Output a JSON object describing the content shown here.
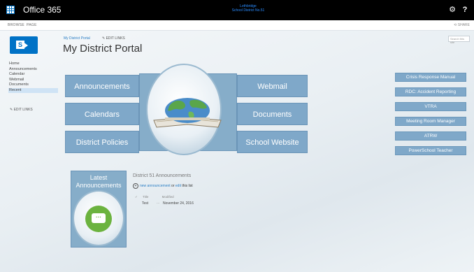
{
  "topbar": {
    "brand": "Office 365",
    "site_name_line1": "Lethbridge",
    "site_name_line2": "School District No.51",
    "settings_icon": "gear-icon",
    "help_icon": "question-icon",
    "help_label": "?"
  },
  "ribbon": {
    "tab_browse": "BROWSE",
    "tab_page": "PAGE",
    "share": "SHARE"
  },
  "header": {
    "breadcrumb": "My District Portal",
    "edit_links": "EDIT LINKS",
    "title": "My District Portal",
    "search_placeholder": "Search this site"
  },
  "leftnav": {
    "items": [
      {
        "label": "Home"
      },
      {
        "label": "Announcements"
      },
      {
        "label": "Calendar"
      },
      {
        "label": "Webmail"
      },
      {
        "label": "Documents"
      },
      {
        "label": "Recent"
      }
    ],
    "edit_links": "EDIT LINKS"
  },
  "tiles": {
    "announcements": "Announcements",
    "calendars": "Calendars",
    "district_policies": "District Policies",
    "webmail": "Webmail",
    "documents": "Documents",
    "school_website": "School Website"
  },
  "sidebar": {
    "buttons": [
      {
        "label": "Crisis Response Manual"
      },
      {
        "label": "RDC: Accident Reporting"
      },
      {
        "label": "VTRA"
      },
      {
        "label": "Meeting Room Manager"
      },
      {
        "label": "ATRW"
      },
      {
        "label": "PowerSchool Teacher"
      }
    ]
  },
  "announcements": {
    "widget_label_line1": "Latest",
    "widget_label_line2": "Announcements",
    "list_title": "District 51 Announcements",
    "new_label": "new announcement",
    "or_text": "or",
    "edit_label": "edit",
    "list_suffix": "this list",
    "col_title": "Title",
    "col_modified": "Modified",
    "rows": [
      {
        "title": "Test",
        "modified": "November 24, 2016"
      }
    ]
  },
  "colors": {
    "tile": "#7fa8c9",
    "accent_blue": "#0072c6",
    "bubble_green": "#6cb33f"
  }
}
